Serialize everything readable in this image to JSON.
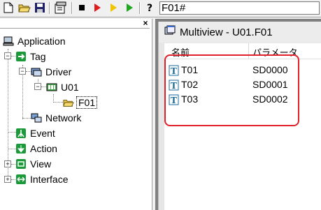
{
  "toolbar": {
    "address_value": "F01#",
    "buttons": [
      "new-file-icon",
      "open-folder-icon",
      "save-icon",
      "properties-icon",
      "stop-icon",
      "run-icon",
      "step-icon",
      "play-icon",
      "help-icon"
    ],
    "colors": {
      "stop": "#000000",
      "run": "#e01b1b",
      "step": "#f0c400",
      "play": "#1fa81f"
    }
  },
  "tree": {
    "close_glyph": "×",
    "items": [
      {
        "label": "Application",
        "icon": "computer-icon"
      },
      {
        "label": "Tag",
        "icon": "tag-icon"
      },
      {
        "label": "Driver",
        "icon": "driver-icon"
      },
      {
        "label": "U01",
        "icon": "unit-icon"
      },
      {
        "label": "F01",
        "icon": "folder-icon"
      },
      {
        "label": "Network",
        "icon": "network-icon"
      },
      {
        "label": "Event",
        "icon": "event-icon"
      },
      {
        "label": "Action",
        "icon": "action-icon"
      },
      {
        "label": "View",
        "icon": "view-icon"
      },
      {
        "label": "Interface",
        "icon": "interface-icon"
      }
    ],
    "expander_minus": "−",
    "expander_plus": "+"
  },
  "multiview": {
    "title": "Multiview - U01.F01",
    "columns": [
      "名前",
      "パラメータ"
    ],
    "rows": [
      {
        "name": "T01",
        "param": "SD0000"
      },
      {
        "name": "T02",
        "param": "SD0001"
      },
      {
        "name": "T03",
        "param": "SD0002"
      }
    ],
    "highlight_color": "#e0202a"
  }
}
